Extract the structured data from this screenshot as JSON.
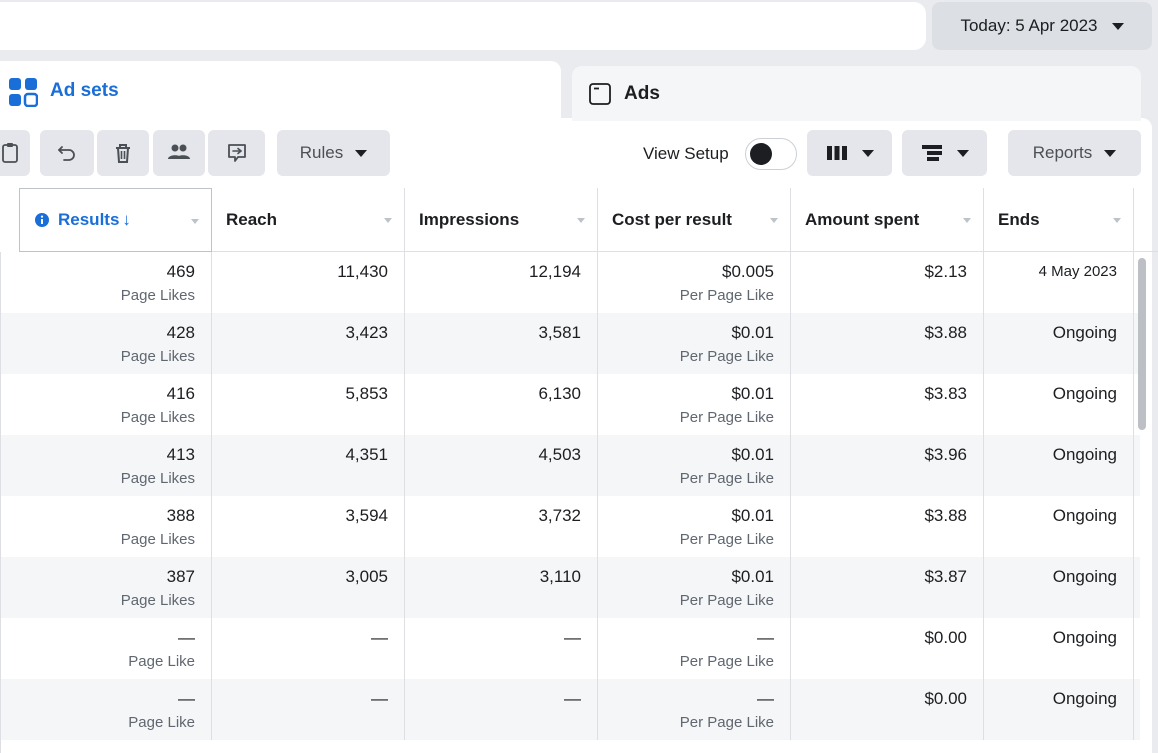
{
  "date_button": {
    "label": "Today: 5 Apr 2023"
  },
  "tabs": {
    "adsets": {
      "label": "Ad sets"
    },
    "ads": {
      "label": "Ads"
    }
  },
  "toolbar": {
    "rules_label": "Rules",
    "view_setup_label": "View Setup",
    "view_setup_on": false,
    "reports_label": "Reports"
  },
  "table": {
    "headers": [
      "Results",
      "Reach",
      "Impressions",
      "Cost per result",
      "Amount spent",
      "Ends"
    ],
    "results_arrow": "↓",
    "rows": [
      {
        "results": "469",
        "results_sub": "Page Likes",
        "reach": "11,430",
        "impressions": "12,194",
        "cpr": "$0.005",
        "cpr_sub": "Per Page Like",
        "spent": "$2.13",
        "ends": "4 May 2023"
      },
      {
        "results": "428",
        "results_sub": "Page Likes",
        "reach": "3,423",
        "impressions": "3,581",
        "cpr": "$0.01",
        "cpr_sub": "Per Page Like",
        "spent": "$3.88",
        "ends": "Ongoing"
      },
      {
        "results": "416",
        "results_sub": "Page Likes",
        "reach": "5,853",
        "impressions": "6,130",
        "cpr": "$0.01",
        "cpr_sub": "Per Page Like",
        "spent": "$3.83",
        "ends": "Ongoing"
      },
      {
        "results": "413",
        "results_sub": "Page Likes",
        "reach": "4,351",
        "impressions": "4,503",
        "cpr": "$0.01",
        "cpr_sub": "Per Page Like",
        "spent": "$3.96",
        "ends": "Ongoing"
      },
      {
        "results": "388",
        "results_sub": "Page Likes",
        "reach": "3,594",
        "impressions": "3,732",
        "cpr": "$0.01",
        "cpr_sub": "Per Page Like",
        "spent": "$3.88",
        "ends": "Ongoing"
      },
      {
        "results": "387",
        "results_sub": "Page Likes",
        "reach": "3,005",
        "impressions": "3,110",
        "cpr": "$0.01",
        "cpr_sub": "Per Page Like",
        "spent": "$3.87",
        "ends": "Ongoing"
      },
      {
        "results": "—",
        "results_sub": "Page Like",
        "reach": "—",
        "impressions": "—",
        "cpr": "—",
        "cpr_sub": "Per Page Like",
        "spent": "$0.00",
        "ends": "Ongoing"
      },
      {
        "results": "—",
        "results_sub": "Page Like",
        "reach": "—",
        "impressions": "—",
        "cpr": "—",
        "cpr_sub": "Per Page Like",
        "spent": "$0.00",
        "ends": "Ongoing"
      }
    ]
  },
  "colors": {
    "accent": "#1a6ed8",
    "row_alt": "#f5f6f7"
  }
}
